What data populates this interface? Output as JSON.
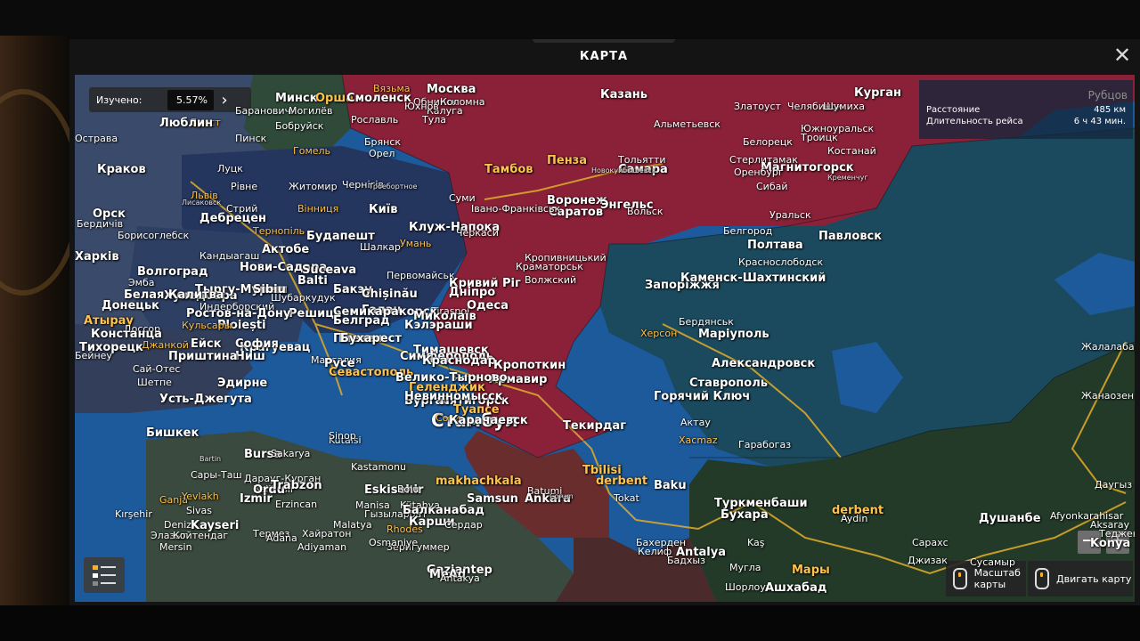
{
  "window": {
    "title": "КАРТА",
    "close_icon": "✕"
  },
  "explored": {
    "label": "Изучено:",
    "value": "5.57%",
    "next_icon": "›"
  },
  "route": {
    "distance_label": "Расстояние",
    "distance_value": "485 км",
    "duration_label": "Длительность рейса",
    "duration_value": "6 ч 43 мин.",
    "destination": "Рубцов"
  },
  "controls": {
    "zoom_out": "−",
    "zoom_in": "+",
    "scale_hint": "Масштаб карты",
    "move_hint": "Двигать карту"
  },
  "colors": {
    "russia": "#8b2138",
    "ukraine": "#24355e",
    "europe_east": "#2d3f63",
    "kazakhstan": "#1b4a5e",
    "central_asia": "#233a28",
    "turkey": "#3b4a3e",
    "caucasus": "#6a2d2d",
    "belarus": "#2f4a38",
    "sea": "#1d5a9c",
    "road": "#d8a72a"
  },
  "map_labels": [
    {
      "text": "Минск",
      "cls": "big"
    },
    {
      "text": "Орша",
      "cls": "big yl"
    },
    {
      "text": "Смоленск",
      "cls": "big"
    },
    {
      "text": "Вязьма",
      "cls": "yl"
    },
    {
      "text": "Москва",
      "cls": "big"
    },
    {
      "text": "Казань",
      "cls": "big"
    },
    {
      "text": "Курган",
      "cls": "big"
    },
    {
      "text": "Брест",
      "cls": "yl"
    },
    {
      "text": "Барановичи",
      "cls": ""
    },
    {
      "text": "Могилёв",
      "cls": ""
    },
    {
      "text": "Люблин",
      "cls": "big"
    },
    {
      "text": "Бобруйск",
      "cls": ""
    },
    {
      "text": "Рославль",
      "cls": ""
    },
    {
      "text": "Тула",
      "cls": ""
    },
    {
      "text": "Калуга",
      "cls": ""
    },
    {
      "text": "Обнинск",
      "cls": ""
    },
    {
      "text": "Юхнов",
      "cls": ""
    },
    {
      "text": "Коломна",
      "cls": ""
    },
    {
      "text": "Златоуст",
      "cls": ""
    },
    {
      "text": "Челябинск",
      "cls": ""
    },
    {
      "text": "Шумиха",
      "cls": ""
    },
    {
      "text": "Альметьевск",
      "cls": ""
    },
    {
      "text": "Южноуральск",
      "cls": ""
    },
    {
      "text": "Троицк",
      "cls": ""
    },
    {
      "text": "Острава",
      "cls": ""
    },
    {
      "text": "Пинск",
      "cls": ""
    },
    {
      "text": "Гомель",
      "cls": "yl"
    },
    {
      "text": "Брянск",
      "cls": ""
    },
    {
      "text": "Орел",
      "cls": ""
    },
    {
      "text": "Белорецк",
      "cls": ""
    },
    {
      "text": "Костанай",
      "cls": ""
    },
    {
      "text": "Стерлитамак",
      "cls": ""
    },
    {
      "text": "Магнитогорск",
      "cls": "big"
    },
    {
      "text": "Краков",
      "cls": "big"
    },
    {
      "text": "Луцк",
      "cls": ""
    },
    {
      "text": "Тамбов",
      "cls": "big yl"
    },
    {
      "text": "Пенза",
      "cls": "big yl"
    },
    {
      "text": "Тольятти",
      "cls": ""
    },
    {
      "text": "Самара",
      "cls": "big"
    },
    {
      "text": "Новокуйбышевск",
      "cls": "sm"
    },
    {
      "text": "Оренбург",
      "cls": ""
    },
    {
      "text": "Сибай",
      "cls": ""
    },
    {
      "text": "Львів",
      "cls": "yl"
    },
    {
      "text": "Рівне",
      "cls": ""
    },
    {
      "text": "Житомир",
      "cls": ""
    },
    {
      "text": "Чернігів",
      "cls": ""
    },
    {
      "text": "Троебортное",
      "cls": "sm"
    },
    {
      "text": "Кременчуг",
      "cls": "sm"
    },
    {
      "text": "Лисаковск",
      "cls": "sm"
    },
    {
      "text": "Стрий",
      "cls": ""
    },
    {
      "text": "Тернопіль",
      "cls": "yl"
    },
    {
      "text": "Вінниця",
      "cls": "yl"
    },
    {
      "text": "Київ",
      "cls": "big"
    },
    {
      "text": "Суми",
      "cls": ""
    },
    {
      "text": "Воронеж",
      "cls": "big"
    },
    {
      "text": "Саратов",
      "cls": "big"
    },
    {
      "text": "Энгельс",
      "cls": "big"
    },
    {
      "text": "Вольск",
      "cls": ""
    },
    {
      "text": "Уральск",
      "cls": ""
    },
    {
      "text": "Орск",
      "cls": "big"
    },
    {
      "text": "Дебрецен",
      "cls": "big"
    },
    {
      "text": "Івано-Франківськ",
      "cls": ""
    },
    {
      "text": "Бердичів",
      "cls": ""
    },
    {
      "text": "Борисоглебск",
      "cls": ""
    },
    {
      "text": "Будапешт",
      "cls": "big"
    },
    {
      "text": "Клуж-Напока",
      "cls": "big"
    },
    {
      "text": "Черкаси",
      "cls": ""
    },
    {
      "text": "Белгород",
      "cls": ""
    },
    {
      "text": "Павловск",
      "cls": "big"
    },
    {
      "text": "Актобе",
      "cls": "big"
    },
    {
      "text": "Шалкар",
      "cls": ""
    },
    {
      "text": "Умань",
      "cls": "yl"
    },
    {
      "text": "Полтава",
      "cls": "big"
    },
    {
      "text": "Харків",
      "cls": "big"
    },
    {
      "text": "Кандыагаш",
      "cls": ""
    },
    {
      "text": "Нови-Садара",
      "cls": "big"
    },
    {
      "text": "Suceava",
      "cls": "big"
    },
    {
      "text": "Balti",
      "cls": "big"
    },
    {
      "text": "Первомайськ",
      "cls": ""
    },
    {
      "text": "Кропивницький",
      "cls": ""
    },
    {
      "text": "Краматорськ",
      "cls": ""
    },
    {
      "text": "Волжский",
      "cls": ""
    },
    {
      "text": "Краснослободск",
      "cls": ""
    },
    {
      "text": "Волгоград",
      "cls": "big"
    },
    {
      "text": "Эмба",
      "cls": ""
    },
    {
      "text": "Хунедоара",
      "cls": "big"
    },
    {
      "text": "Тыргу-Муреш",
      "cls": "big"
    },
    {
      "text": "Sibiu",
      "cls": "big"
    },
    {
      "text": "Бакэу",
      "cls": "big"
    },
    {
      "text": "Chișinău",
      "cls": "big"
    },
    {
      "text": "Кривий Ріг",
      "cls": "big"
    },
    {
      "text": "Дніпро",
      "cls": "big"
    },
    {
      "text": "Запоріжжя",
      "cls": "big"
    },
    {
      "text": "Каменск-Шахтинский",
      "cls": "big"
    },
    {
      "text": "Белая Калитва",
      "cls": "big"
    },
    {
      "text": "Индерборский",
      "cls": ""
    },
    {
      "text": "Шубаркудук",
      "cls": ""
    },
    {
      "text": "Решица",
      "cls": "big"
    },
    {
      "text": "Галац",
      "cls": "big"
    },
    {
      "text": "Tiraspol",
      "cls": ""
    },
    {
      "text": "Одеса",
      "cls": "big"
    },
    {
      "text": "Донецьк",
      "cls": "big"
    },
    {
      "text": "Ростов-на-Дону",
      "cls": "big"
    },
    {
      "text": "Семикаракорск",
      "cls": "big"
    },
    {
      "text": "Белград",
      "cls": "big"
    },
    {
      "text": "Ploiești",
      "cls": "big"
    },
    {
      "text": "Миколаїв",
      "cls": "big"
    },
    {
      "text": "Херсон",
      "cls": "yl"
    },
    {
      "text": "Бердянськ",
      "cls": ""
    },
    {
      "text": "Маріуполь",
      "cls": "big"
    },
    {
      "text": "Атырау",
      "cls": "big yl"
    },
    {
      "text": "Доссор",
      "cls": ""
    },
    {
      "text": "Кульсары",
      "cls": "yl"
    },
    {
      "text": "Крагуевац",
      "cls": "big"
    },
    {
      "text": "Плевен",
      "cls": "big"
    },
    {
      "text": "Кэлэраши",
      "cls": "big"
    },
    {
      "text": "Констанца",
      "cls": "big"
    },
    {
      "text": "Джанкой",
      "cls": "yl"
    },
    {
      "text": "Ейск",
      "cls": "big"
    },
    {
      "text": "София",
      "cls": "big"
    },
    {
      "text": "Бухарест",
      "cls": "big"
    },
    {
      "text": "Тимашевск",
      "cls": "big"
    },
    {
      "text": "Тихорецк",
      "cls": "big"
    },
    {
      "text": "Ниш",
      "cls": "big"
    },
    {
      "text": "Мангалия",
      "cls": ""
    },
    {
      "text": "Симферополь",
      "cls": "big"
    },
    {
      "text": "Краснодар",
      "cls": "big"
    },
    {
      "text": "Кропоткин",
      "cls": "big"
    },
    {
      "text": "Александровск",
      "cls": "big"
    },
    {
      "text": "Бейнеу",
      "cls": ""
    },
    {
      "text": "Приштина",
      "cls": "big"
    },
    {
      "text": "Русе",
      "cls": "big"
    },
    {
      "text": "Севастополь",
      "cls": "big yl"
    },
    {
      "text": "Ялта",
      "cls": ""
    },
    {
      "text": "Армавир",
      "cls": "big"
    },
    {
      "text": "Ставрополь",
      "cls": "big"
    },
    {
      "text": "Сай-Отес",
      "cls": ""
    },
    {
      "text": "Велико-Тырново",
      "cls": "big"
    },
    {
      "text": "Геленджик",
      "cls": "big yl"
    },
    {
      "text": "Горячий Ключ",
      "cls": "big"
    },
    {
      "text": "Шетпе",
      "cls": ""
    },
    {
      "text": "Эдирне",
      "cls": "big"
    },
    {
      "text": "Бургас",
      "cls": "big"
    },
    {
      "text": "Пятигорск",
      "cls": "big"
    },
    {
      "text": "Невинномысск",
      "cls": "big"
    },
    {
      "text": "Туапсе",
      "cls": "big yl"
    },
    {
      "text": "Усть-Джегута",
      "cls": "big"
    },
    {
      "text": "Стамбул",
      "cls": "huge"
    },
    {
      "text": "Сочи",
      "cls": "yl"
    },
    {
      "text": "Карачаевск",
      "cls": "big"
    },
    {
      "text": "Актау",
      "cls": ""
    },
    {
      "text": "Жанаозен",
      "cls": ""
    },
    {
      "text": "Жалалабат",
      "cls": ""
    },
    {
      "text": "Бишкек",
      "cls": "big"
    },
    {
      "text": "Текирдаг",
      "cls": "big"
    },
    {
      "text": "makhachkala",
      "cls": "big yl"
    },
    {
      "text": "Kutaisi",
      "cls": ""
    },
    {
      "text": "Sinop",
      "cls": ""
    },
    {
      "text": "Bartin",
      "cls": "sm"
    },
    {
      "text": "Bursa",
      "cls": "big"
    },
    {
      "text": "Sakarya",
      "cls": ""
    },
    {
      "text": "Kastamonu",
      "cls": ""
    },
    {
      "text": "Samsun",
      "cls": "big"
    },
    {
      "text": "Batumi",
      "cls": ""
    },
    {
      "text": "Tbilisi",
      "cls": "big yl"
    },
    {
      "text": "derbent",
      "cls": "big yl"
    },
    {
      "text": "Xacmaz",
      "cls": "yl"
    },
    {
      "text": "Гарабогаз",
      "cls": ""
    },
    {
      "text": "Даугыз",
      "cls": ""
    },
    {
      "text": "Сары-Таш",
      "cls": ""
    },
    {
      "text": "Дарауг-Курган",
      "cls": ""
    },
    {
      "text": "Balikesir",
      "cls": ""
    },
    {
      "text": "Eskisehir",
      "cls": "big"
    },
    {
      "text": "Bolu",
      "cls": ""
    },
    {
      "text": "Ordu",
      "cls": "big"
    },
    {
      "text": "Trabzon",
      "cls": "big"
    },
    {
      "text": "Ganja",
      "cls": "yl"
    },
    {
      "text": "Yevlakh",
      "cls": "yl"
    },
    {
      "text": "Izmir",
      "cls": "big"
    },
    {
      "text": "Manisa",
      "cls": ""
    },
    {
      "text": "Kütahya",
      "cls": ""
    },
    {
      "text": "Ankara",
      "cls": "big"
    },
    {
      "text": "Çorum",
      "cls": "sm"
    },
    {
      "text": "Tokat",
      "cls": ""
    },
    {
      "text": "Baku",
      "cls": "big"
    },
    {
      "text": "Туркменбаши",
      "cls": "big"
    },
    {
      "text": "Бухара",
      "cls": "big"
    },
    {
      "text": "Душанбе",
      "cls": "big"
    },
    {
      "text": "Afyonkarahisar",
      "cls": ""
    },
    {
      "text": "Kırşehir",
      "cls": ""
    },
    {
      "text": "Sivas",
      "cls": ""
    },
    {
      "text": "Erzincan",
      "cls": ""
    },
    {
      "text": "Гызыларбат",
      "cls": ""
    },
    {
      "text": "Балканабад",
      "cls": "big"
    },
    {
      "text": "Карши",
      "cls": "big"
    },
    {
      "text": "derbent",
      "cls": "big yl"
    },
    {
      "text": "Aydin",
      "cls": ""
    },
    {
      "text": "Denizli",
      "cls": ""
    },
    {
      "text": "Kayseri",
      "cls": "big"
    },
    {
      "text": "Malatya",
      "cls": ""
    },
    {
      "text": "Сердар",
      "cls": ""
    },
    {
      "text": "Бахерден",
      "cls": ""
    },
    {
      "text": "Келиф",
      "cls": ""
    },
    {
      "text": "Бадхыз",
      "cls": ""
    },
    {
      "text": "Муглa",
      "cls": ""
    },
    {
      "text": "Konya",
      "cls": "big"
    },
    {
      "text": "Aksaray",
      "cls": ""
    },
    {
      "text": "Элазыг",
      "cls": ""
    },
    {
      "text": "Койтендаг",
      "cls": ""
    },
    {
      "text": "Термез",
      "cls": ""
    },
    {
      "text": "Хайратон",
      "cls": ""
    },
    {
      "text": "Rhodes",
      "cls": "yl"
    },
    {
      "text": "Kaş",
      "cls": ""
    },
    {
      "text": "Antalya",
      "cls": "big"
    },
    {
      "text": "Mersin",
      "cls": ""
    },
    {
      "text": "Adana",
      "cls": ""
    },
    {
      "text": "Adiyaman",
      "cls": ""
    },
    {
      "text": "Зеригуммер",
      "cls": ""
    },
    {
      "text": "Шорлоуз",
      "cls": ""
    },
    {
      "text": "Ашхабад",
      "cls": "big"
    },
    {
      "text": "Мары",
      "cls": "big yl"
    },
    {
      "text": "Теджен",
      "cls": ""
    },
    {
      "text": "Osmaniye",
      "cls": ""
    },
    {
      "text": "Gaziantep",
      "cls": "big"
    },
    {
      "text": "MeAd",
      "cls": "big"
    },
    {
      "text": "Antakya",
      "cls": ""
    },
    {
      "text": "Сарахс",
      "cls": ""
    },
    {
      "text": "Джизак",
      "cls": ""
    },
    {
      "text": "Сусамыр",
      "cls": ""
    }
  ]
}
